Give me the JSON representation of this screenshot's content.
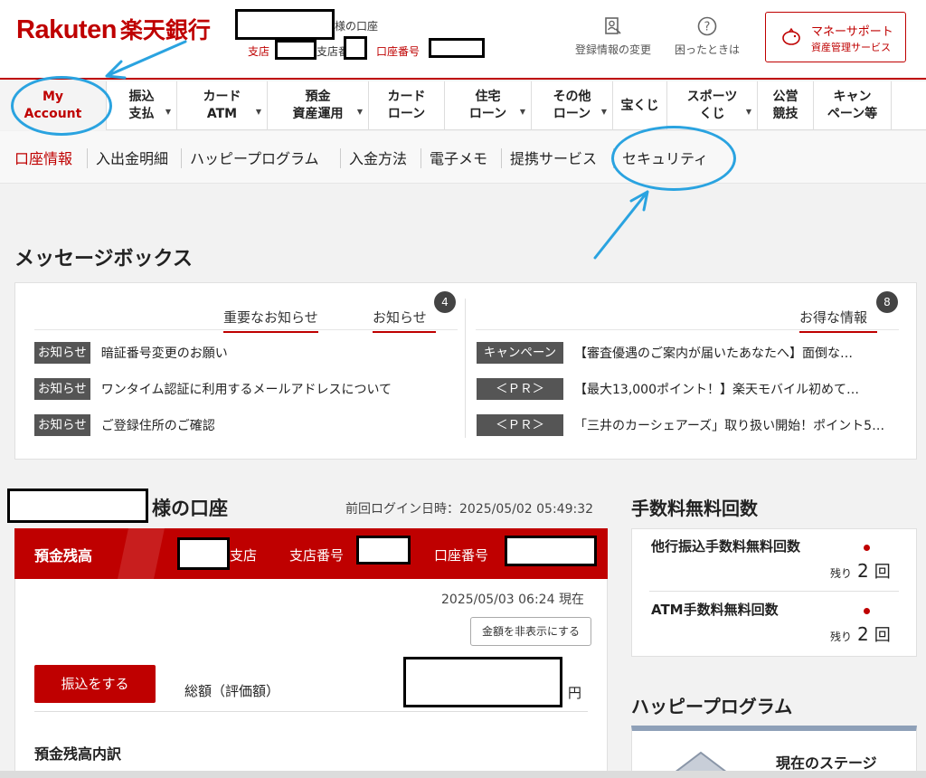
{
  "header": {
    "logo_en": "Rakuten",
    "logo_jp": "楽天銀行",
    "account_suffix": "様の口座",
    "branch_label": "支店",
    "branch_no_label": "支店番号",
    "account_no_label": "口座番号",
    "links": [
      {
        "label": "登録情報の変更",
        "icon": "profile-edit-icon"
      },
      {
        "label": "困ったときは",
        "icon": "help-icon"
      }
    ],
    "money_support": {
      "line1": "マネーサポート",
      "line2": "資産管理サービス",
      "icon": "piggy-bank-icon"
    }
  },
  "global_nav": [
    {
      "label": "My\nAccount",
      "active": true,
      "caret": false
    },
    {
      "label": "振込\n支払",
      "caret": true
    },
    {
      "label": "カード\nATM",
      "caret": true
    },
    {
      "label": "預金\n資産運用",
      "caret": true
    },
    {
      "label": "カード\nローン",
      "caret": false
    },
    {
      "label": "住宅\nローン",
      "caret": true
    },
    {
      "label": "その他\nローン",
      "caret": true
    },
    {
      "label": "宝くじ",
      "caret": false
    },
    {
      "label": "スポーツ\nくじ",
      "caret": true
    },
    {
      "label": "公営\n競技",
      "caret": false
    },
    {
      "label": "キャン\nペーン等",
      "caret": false
    }
  ],
  "sub_nav": [
    "口座情報",
    "入出金明細",
    "ハッピープログラム",
    "入金方法",
    "電子メモ",
    "提携サービス",
    "セキュリティ"
  ],
  "message_box": {
    "title": "メッセージボックス",
    "tab_important": "重要なお知らせ",
    "tab_notice": "お知らせ",
    "notice_count": "4",
    "tab_deals": "お得な情報",
    "deals_count": "8",
    "notices": [
      {
        "tag": "お知らせ",
        "text": "暗証番号変更のお願い"
      },
      {
        "tag": "お知らせ",
        "text": "ワンタイム認証に利用するメールアドレスについて"
      },
      {
        "tag": "お知らせ",
        "text": "ご登録住所のご確認"
      }
    ],
    "deals": [
      {
        "tag": "キャンペーン",
        "text": "【審査優遇のご案内が届いたあなたへ】面倒な…"
      },
      {
        "tag": "＜ＰＲ＞",
        "text": "【最大13,000ポイント！】楽天モバイル初めて…"
      },
      {
        "tag": "＜ＰＲ＞",
        "text": "「三井のカーシェアーズ」取り扱い開始！ポイント5…"
      }
    ]
  },
  "account": {
    "title_suffix": "様の口座",
    "last_login": "前回ログイン日時：2025/05/02 05:49:32",
    "balance_label": "預金残高",
    "branch_label": "支店",
    "branch_no_label": "支店番号",
    "account_no_label": "口座番号",
    "as_of": "2025/05/03 06:24 現在",
    "hide_button": "金額を非表示にする",
    "transfer_button": "振込をする",
    "total_label": "総額（評価額）",
    "yen": "円",
    "breakdown_title": "預金残高内訳"
  },
  "fees": {
    "title": "手数料無料回数",
    "items": [
      {
        "label": "他行振込手数料無料回数",
        "remain_label": "残り",
        "count": "2",
        "unit": "回"
      },
      {
        "label": "ATM手数料無料回数",
        "remain_label": "残り",
        "count": "2",
        "unit": "回"
      }
    ]
  },
  "happy": {
    "title": "ハッピープログラム",
    "stage_label": "現在のステージ"
  },
  "colors": {
    "brand": "#bf0000",
    "annotation": "#2aa3e0"
  }
}
